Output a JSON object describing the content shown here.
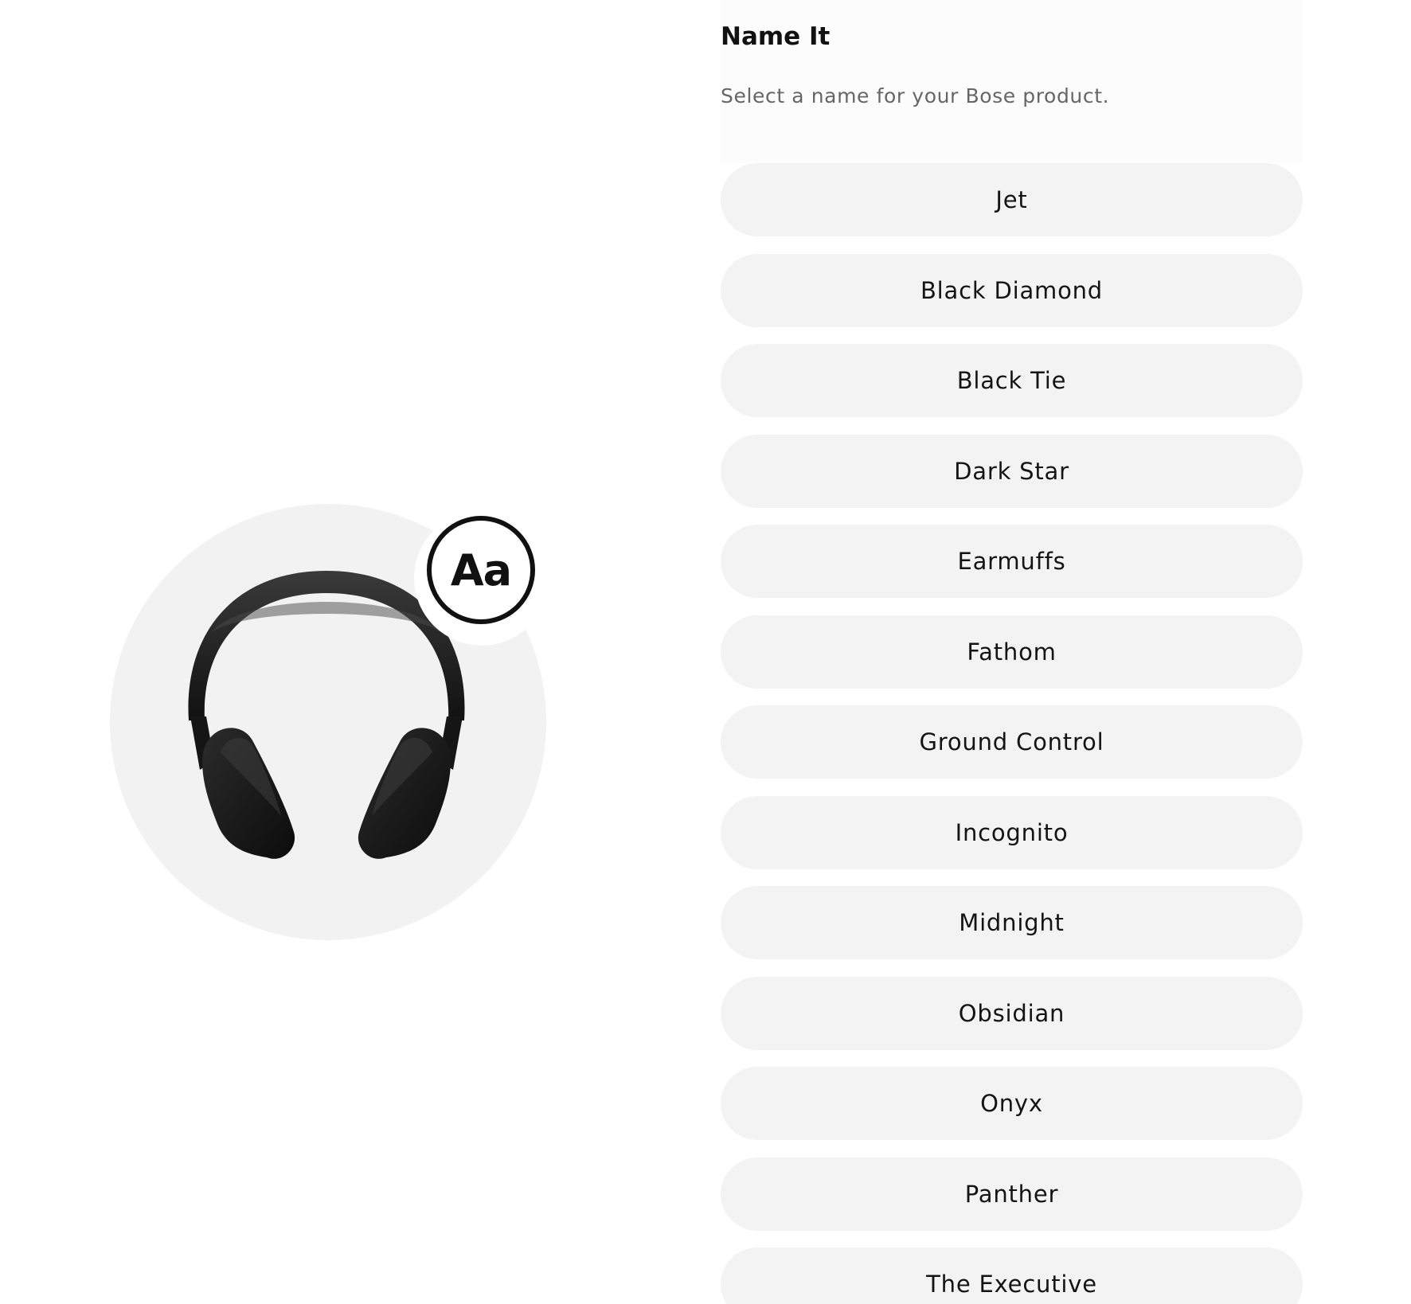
{
  "header": {
    "title": "Name It",
    "subtitle": "Select a name for your Bose product."
  },
  "illustration": {
    "badge_text": "Aa",
    "product_icon": "headphones-icon"
  },
  "name_options": [
    "Jet",
    "Black Diamond",
    "Black Tie",
    "Dark Star",
    "Earmuffs",
    "Fathom",
    "Ground Control",
    "Incognito",
    "Midnight",
    "Obsidian",
    "Onyx",
    "Panther",
    "The Executive"
  ],
  "colors": {
    "option_background": "#f3f3f3",
    "circle_background": "#f2f2f2",
    "text": "#141414",
    "subtitle": "#666666",
    "headphones": "#1a1a1a"
  }
}
